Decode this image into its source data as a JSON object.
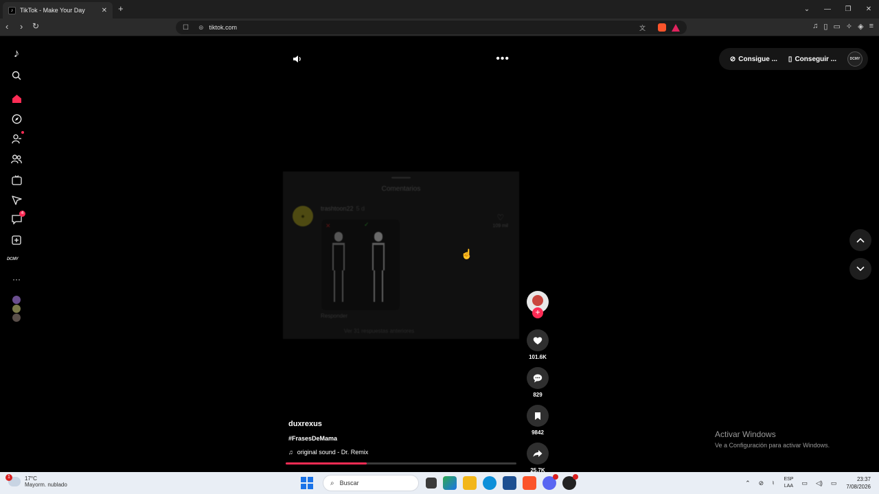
{
  "browser": {
    "tab_title": "TikTok - Make Your Day",
    "tab_close": "✕",
    "new_tab": "+",
    "url": "tiktok.com",
    "window_controls": [
      "⌄",
      "—",
      "❐",
      "✕"
    ]
  },
  "sidebar": {
    "brand_text": "DCMY",
    "messages_badge": "4"
  },
  "video": {
    "overlay_title": "Comentarios",
    "overlay_user": "trashtoon22",
    "overlay_time": "5 d",
    "overlay_likes": "109 mil",
    "overlay_reply": "Responder",
    "overlay_more": "Ver 31 respuestas anteriores",
    "author": "duxrexus",
    "hashtags": "#FrasesDeMama",
    "music": "original sound - Dr. Remix",
    "progress": 0.35
  },
  "actions": {
    "likes": "101.6K",
    "comments": "829",
    "saves": "9842",
    "shares": "25.7K"
  },
  "topbar": {
    "coins_label": "Consigue ...",
    "app_label": "Conseguir ...",
    "profile_text": "DCMY"
  },
  "windows_notice": {
    "title": "Activar Windows",
    "subtitle": "Ve a Configuración para activar Windows."
  },
  "taskbar": {
    "weather_badge": "1",
    "temperature": "17°C",
    "condition": "Mayorm. nublado",
    "search_placeholder": "Buscar",
    "lang_top": "ESP",
    "lang_bottom": "LAA",
    "time": "23:37",
    "date": "7/08/2026"
  },
  "colors": {
    "accent": "#fe2c55",
    "background": "#000000",
    "taskbar": "#e9eef5"
  }
}
